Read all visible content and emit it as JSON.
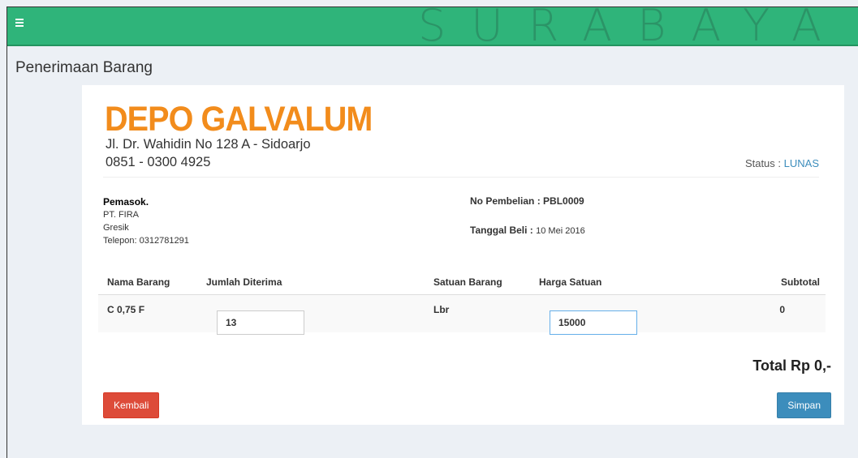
{
  "header": {
    "watermark": "SURABAYA"
  },
  "page": {
    "title": "Penerimaan Barang"
  },
  "company": {
    "name": "DEPO GALVALUM",
    "address": "Jl. Dr. Wahidin No 128 A - Sidoarjo",
    "phone": "0851 - 0300 4925"
  },
  "status": {
    "label": "Status :",
    "value": "LUNAS"
  },
  "supplier": {
    "label": "Pemasok.",
    "name": "PT. FIRA",
    "city": "Gresik",
    "phone": "Telepon: 0312781291"
  },
  "purchase": {
    "no_label": "No Pembelian :",
    "no_value": "PBL0009",
    "date_label": "Tanggal Beli :",
    "date_value": "10 Mei 2016"
  },
  "table": {
    "headers": [
      "Nama Barang",
      "Jumlah Diterima",
      "Satuan Barang",
      "Harga Satuan",
      "Subtotal"
    ],
    "rows": [
      {
        "name": "C 0,75 F",
        "qty": "13",
        "unit": "Lbr",
        "price": "15000",
        "subtotal": "0"
      }
    ]
  },
  "total": "Total Rp 0,-",
  "buttons": {
    "back": "Kembali",
    "save": "Simpan"
  },
  "colors": {
    "topbar": "#2fb47a",
    "logo": "#f28c1c",
    "status": "#3c8dbc",
    "back_button": "#dd4b39",
    "save_button": "#3c8dbc"
  }
}
